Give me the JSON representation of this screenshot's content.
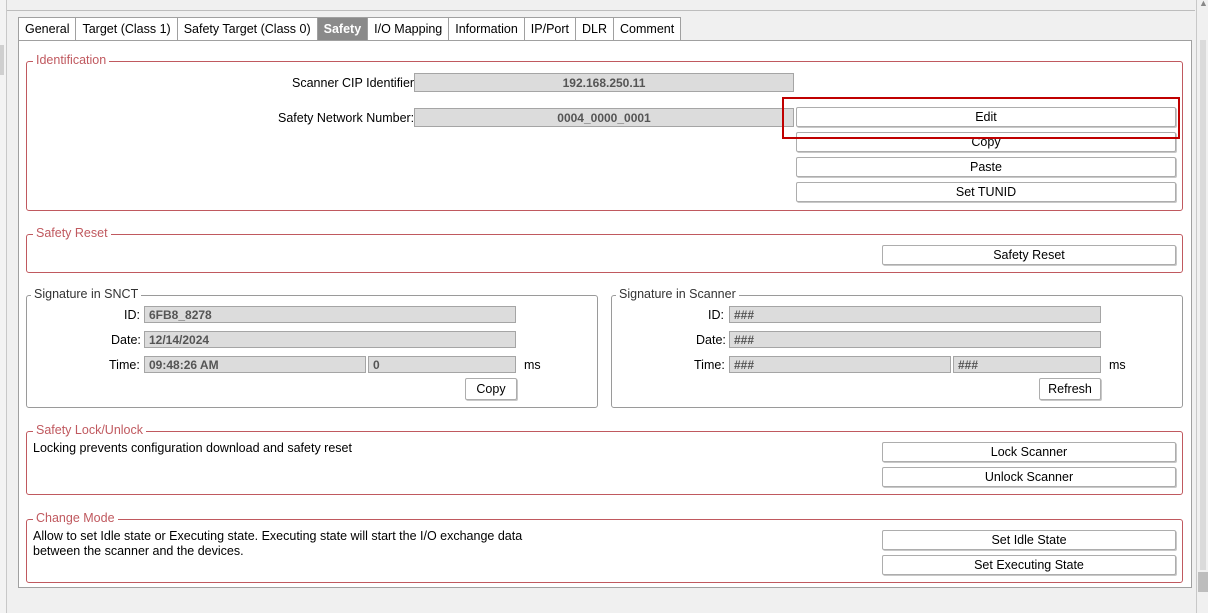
{
  "tabs": [
    {
      "label": "General"
    },
    {
      "label": "Target (Class 1)"
    },
    {
      "label": "Safety Target (Class 0)"
    },
    {
      "label": "Safety",
      "active": true
    },
    {
      "label": "I/O Mapping"
    },
    {
      "label": "Information"
    },
    {
      "label": "IP/Port"
    },
    {
      "label": "DLR"
    },
    {
      "label": "Comment"
    }
  ],
  "identification": {
    "title": "Identification",
    "scanner_cip_label": "Scanner CIP Identifier:",
    "scanner_cip_value": "192.168.250.11",
    "snn_label": "Safety Network Number:",
    "snn_value": "0004_0000_0001",
    "edit": "Edit",
    "copy": "Copy",
    "paste": "Paste",
    "set_tunid": "Set TUNID"
  },
  "safety_reset": {
    "title": "Safety Reset",
    "button": "Safety Reset"
  },
  "signature_snct": {
    "title": "Signature in SNCT",
    "id_label": "ID:",
    "id_value": "6FB8_8278",
    "date_label": "Date:",
    "date_value": "12/14/2024",
    "time_label": "Time:",
    "time_value": "09:48:26 AM",
    "ms_value": "0",
    "ms_unit": "ms",
    "copy": "Copy"
  },
  "signature_scanner": {
    "title": "Signature in Scanner",
    "id_label": "ID:",
    "id_value": "###",
    "date_label": "Date:",
    "date_value": "###",
    "time_label": "Time:",
    "time_value": "###",
    "ms_value": "###",
    "ms_unit": "ms",
    "refresh": "Refresh"
  },
  "lock": {
    "title": "Safety Lock/Unlock",
    "description": "Locking prevents configuration download and safety reset",
    "lock": "Lock Scanner",
    "unlock": "Unlock Scanner"
  },
  "mode": {
    "title": "Change Mode",
    "description_line1": "Allow to set Idle state or Executing state. Executing state will start the I/O exchange data",
    "description_line2": "between the scanner and the devices.",
    "idle": "Set Idle State",
    "executing": "Set Executing State"
  },
  "colors": {
    "group_border": "#c0595f",
    "highlight": "#c00000",
    "active_tab": "#8a8a8a"
  }
}
